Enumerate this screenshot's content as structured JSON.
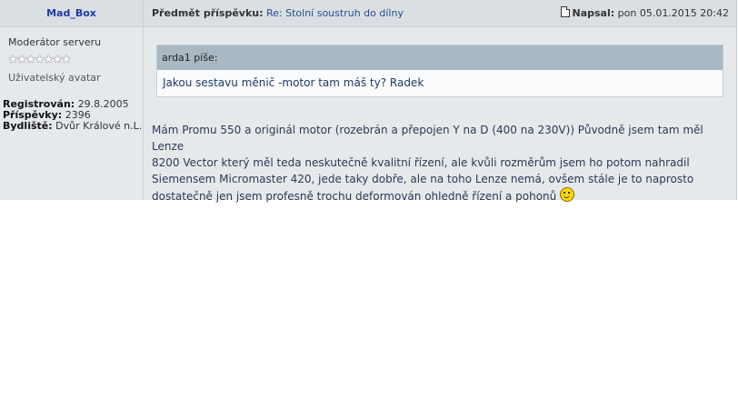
{
  "author": {
    "name": "Mad_Box",
    "rank": "Moderátor serveru",
    "star_count": 7,
    "avatar_text": "Uživatelský avatar",
    "registered_label": "Registrován:",
    "registered_value": "29.8.2005",
    "posts_label": "Příspěvky:",
    "posts_value": "2396",
    "location_label": "Bydliště:",
    "location_value": "Dvůr Králové n.L."
  },
  "post": {
    "subject_label": "Předmět příspěvku:",
    "subject": "Re: Stolní soustruh do dílny",
    "posted_label": "Napsal:",
    "posted_value": "pon 05.01.2015 20:42",
    "quote_author": "arda1 píše:",
    "quote_text": "Jakou sestavu měnič -motor tam máš ty? Radek",
    "body_lines": [
      "Mám Promu 550 a originál motor (rozebrán a přepojen Y na D (400 na 230V)) Původně jsem tam měl Lenze",
      "8200 Vector který měl teda neskutečně kvalitní řízení, ale kvůli rozměrům jsem ho potom nahradil",
      "Siemensem Micromaster 420, jede taky dobře, ale na toho Lenze nemá, ovšem stále je to naprosto",
      "dostatečně jen jsem profesně trochu deformován ohledně řízení a pohonů"
    ],
    "smiley": "wink-smiley-icon"
  }
}
